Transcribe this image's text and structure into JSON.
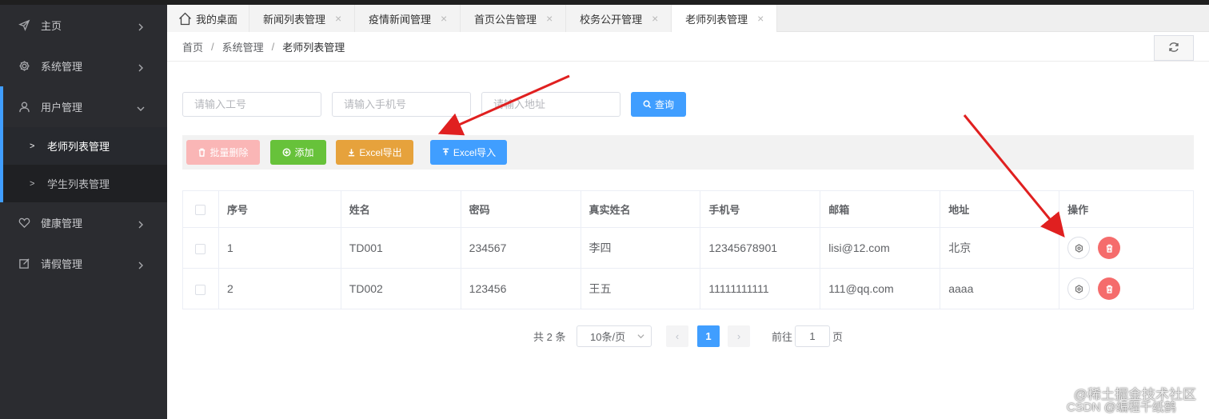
{
  "sidebar": {
    "items": [
      {
        "label": "主页",
        "icon": "send-icon"
      },
      {
        "label": "系统管理",
        "icon": "gear-icon"
      },
      {
        "label": "用户管理",
        "icon": "user-icon"
      },
      {
        "label": "健康管理",
        "icon": "heart-icon"
      },
      {
        "label": "请假管理",
        "icon": "edit-icon"
      }
    ],
    "sub_items": [
      {
        "label": "老师列表管理",
        "active": true
      },
      {
        "label": "学生列表管理",
        "active": false
      }
    ]
  },
  "tabs": [
    {
      "label": "我的桌面"
    },
    {
      "label": "新闻列表管理"
    },
    {
      "label": "疫情新闻管理"
    },
    {
      "label": "首页公告管理"
    },
    {
      "label": "校务公开管理"
    },
    {
      "label": "老师列表管理"
    }
  ],
  "breadcrumb": [
    "首页",
    "系统管理",
    "老师列表管理"
  ],
  "search": {
    "id_placeholder": "请输入工号",
    "phone_placeholder": "请输入手机号",
    "address_placeholder": "请输入地址",
    "query_label": "查询"
  },
  "toolbar": {
    "batch_delete_label": "批量删除",
    "add_label": "添加",
    "export_label": "Excel导出",
    "import_label": "Excel导入"
  },
  "colors": {
    "primary": "#409eff",
    "success": "#67c23a",
    "warning": "#e6a23c",
    "danger": "#f56c6c",
    "danger_disabled": "#fab6b6"
  },
  "table": {
    "headers": [
      "序号",
      "姓名",
      "密码",
      "真实姓名",
      "手机号",
      "邮箱",
      "地址",
      "操作"
    ],
    "rows": [
      [
        "1",
        "TD001",
        "234567",
        "李四",
        "12345678901",
        "lisi@12.com",
        "北京"
      ],
      [
        "2",
        "TD002",
        "123456",
        "王五",
        "11111111111",
        "111@qq.com",
        "aaaa"
      ]
    ]
  },
  "pagination": {
    "total_text": "共 2 条",
    "page_size": "10条/页",
    "current_page": "1",
    "goto_label": "前往",
    "goto_value": "1",
    "page_suffix": "页"
  },
  "watermark": {
    "line1": "@稀土掘金技术社区",
    "line2": "CSDN @编程千纸鹤"
  }
}
